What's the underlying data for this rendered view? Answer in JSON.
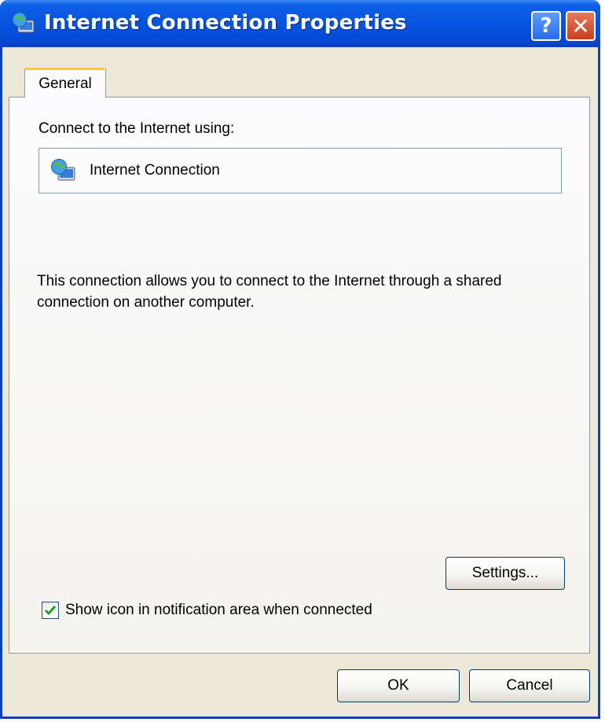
{
  "window": {
    "title": "Internet Connection Properties",
    "help_glyph": "?",
    "close_glyph": "✕",
    "title_icon": "network-connection-icon"
  },
  "tabs": [
    {
      "label": "General",
      "selected": true
    }
  ],
  "general": {
    "connect_label": "Connect to the Internet using:",
    "connection_name": "Internet Connection",
    "connection_icon": "network-connection-icon",
    "description": "This connection allows you to connect to the Internet through a shared connection on another computer.",
    "settings_label": "Settings...",
    "show_icon_label": "Show icon in notification area when connected",
    "show_icon_checked": true
  },
  "footer": {
    "ok_label": "OK",
    "cancel_label": "Cancel"
  },
  "colors": {
    "titlebar": "#0753e0",
    "dialog_bg": "#ece9d8",
    "tab_accent": "#ffc83c",
    "close_button": "#c8401e",
    "check_mark": "#21a121"
  }
}
